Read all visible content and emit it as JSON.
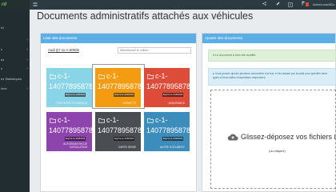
{
  "app": {
    "logo_text": "rd"
  },
  "topbar": {
    "menu_glyph": "≣",
    "icons": [
      "share-icon",
      "pencil-icon",
      "help-icon",
      "flag-icon"
    ],
    "counter": "1",
    "user_name": "Achnen-ma44iCo"
  },
  "sidebar": {
    "items": [
      {
        "label": "rd",
        "has_children": false
      },
      {
        "label": "",
        "has_children": true
      },
      {
        "label": "s",
        "has_children": true
      },
      {
        "label": "es",
        "has_children": true
      },
      {
        "label": "s",
        "has_children": true
      },
      {
        "label": "es Statistiques",
        "has_children": false
      },
      {
        "label": "ions",
        "has_children": true
      },
      {
        "label": "",
        "has_children": false
      }
    ]
  },
  "page": {
    "title": "Documents administratifs attachés aux véhicules"
  },
  "documents_panel": {
    "header": "Liste des documents",
    "vehicle_label": "Audi Q7 11-A-50606",
    "search_placeholder": "Sélectionner le voiture",
    "tiles": [
      {
        "code": "c-1-",
        "number": "14077895878",
        "expiry": "Expire le 24/04/24",
        "label": "CONTRÔLE TECHNIQUE",
        "color": "#8ad4e8"
      },
      {
        "code": "c-1-",
        "number": "14077895878",
        "expiry": "Expire le 24/04/24",
        "label": "VIGNETTE",
        "color": "#f39c12"
      },
      {
        "code": "c-1-",
        "number": "14077895878",
        "expiry": "Expire le 24/04/24",
        "label": "ASSURANCE",
        "color": "#dd4b39"
      },
      {
        "code": "c-1-",
        "number": "14077895878",
        "expiry": "Expire le 24/04/24",
        "label": "AUTORISATION DE\nCIRCULATION",
        "color": "#8e44ad"
      },
      {
        "code": "c-1-",
        "number": "14077895878",
        "expiry": "Expire le 24/04/24",
        "label": "CARTE GRISE",
        "color": "#4a4d52"
      },
      {
        "code": "c-1-",
        "number": "14077895878",
        "expiry": "Expire le 24/04/24",
        "label": "AUTRE DOCUMENT",
        "color": "#3c8dbc"
      }
    ]
  },
  "upload_panel": {
    "header": "Ajouter des documents",
    "success_message": "Le document a bien été modifié.",
    "info_message": "Vous pouvez ajouter plusieurs documents à la fois, et les classer par la suite pour spécifier leurs types et leurs dates d'expirations respectives.",
    "dropzone_text": "Glissez-déposez vos fichiers ici",
    "dropzone_subtext": "(ou cliquez)"
  }
}
